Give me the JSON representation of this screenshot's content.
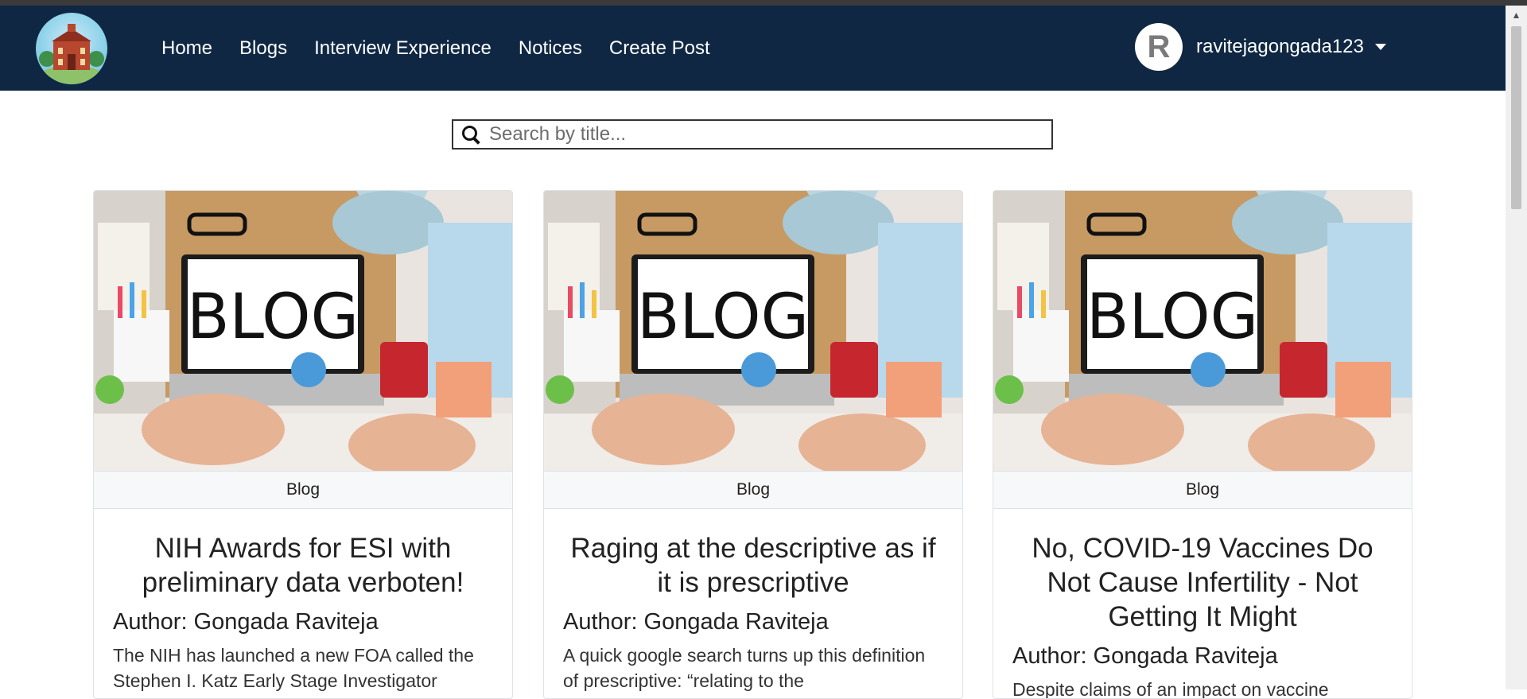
{
  "nav": {
    "links": [
      "Home",
      "Blogs",
      "Interview Experience",
      "Notices",
      "Create Post"
    ],
    "avatar_letter": "R",
    "username": "ravitejagongada123"
  },
  "search": {
    "placeholder": "Search by title..."
  },
  "posts": [
    {
      "category": "Blog",
      "title": "NIH Awards for ESI with preliminary data verboten!",
      "author": "Author: Gongada Raviteja",
      "excerpt": "The NIH has launched a new FOA called the Stephen I. Katz Early Stage Investigator"
    },
    {
      "category": "Blog",
      "title": "Raging at the descriptive as if it is prescriptive",
      "author": "Author: Gongada Raviteja",
      "excerpt": "A quick google search turns up this definition of prescriptive: “relating to the"
    },
    {
      "category": "Blog",
      "title": "No, COVID-19 Vaccines Do Not Cause Infertility - Not Getting It Might",
      "author": "Author: Gongada Raviteja",
      "excerpt": "Despite claims of an impact on vaccine"
    }
  ],
  "image": {
    "board_text": "BLOG"
  },
  "colors": {
    "navbar": "#0f2743",
    "card_border": "#dfe2e6",
    "category_bg": "#f7f8f9"
  }
}
